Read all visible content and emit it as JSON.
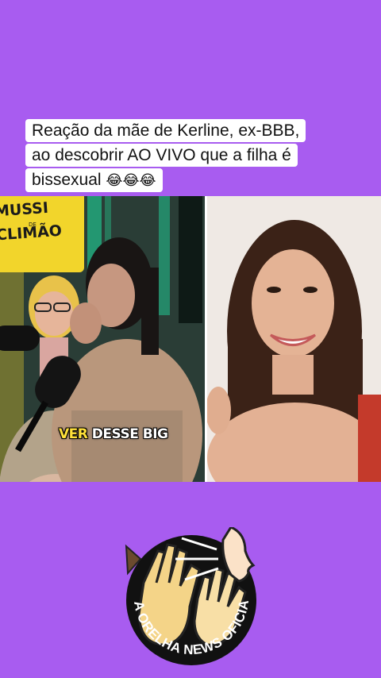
{
  "caption": {
    "line1": "Reação da mãe de Kerline, ex-BBB,",
    "line2": "ao descobrir AO VIVO que a filha é",
    "line3": "bissexual",
    "emojis": "😂😂😂"
  },
  "video": {
    "left_sign": "MUSSI DE CLIMÃO",
    "left_sign_line1": "MUSSI",
    "left_sign_line2": "CLIMÃO",
    "left_sign_small": "DE",
    "subtitle_highlight": "VER",
    "subtitle_rest": "DESSE BIG"
  },
  "logo": {
    "text": "NA ORELHA NEWS OFICIAL"
  },
  "colors": {
    "background": "#a85cf0",
    "caption_bg": "#ffffff",
    "sign": "#f2d52b",
    "subtitle_highlight": "#ffe13a"
  }
}
